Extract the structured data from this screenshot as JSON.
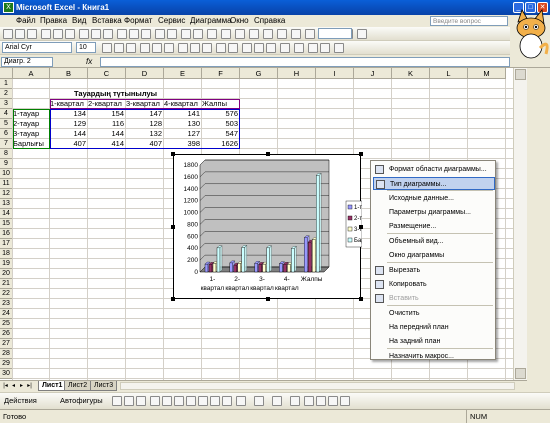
{
  "window": {
    "title": "Microsoft Excel - Книга1"
  },
  "menu": [
    "Файл",
    "Правка",
    "Вид",
    "Вставка",
    "Формат",
    "Сервис",
    "Диаграмма",
    "Окно",
    "Справка"
  ],
  "ask_placeholder": "Введите вопрос",
  "toolbar": {
    "font": "Arial Cyr",
    "size": "10",
    "zoom": ""
  },
  "namebox": "Диагр. 2",
  "fx": "fx",
  "columns": [
    "A",
    "B",
    "C",
    "D",
    "E",
    "F",
    "G",
    "H",
    "I",
    "J",
    "K",
    "L",
    "M"
  ],
  "rows": [
    "1",
    "2",
    "3",
    "4",
    "5",
    "6",
    "7",
    "8",
    "9",
    "10",
    "11",
    "12",
    "13",
    "14",
    "15",
    "16",
    "17",
    "18",
    "19",
    "20",
    "21",
    "22",
    "23",
    "24",
    "25",
    "26",
    "27",
    "28",
    "29",
    "30"
  ],
  "sheet": {
    "title": "Тауардың түтынылуы",
    "headers": [
      "1-квартал",
      "2-квартал",
      "3-квартал",
      "4-квартал",
      "Жалпы"
    ],
    "data": [
      {
        "label": "1-тауар",
        "values": [
          "134",
          "154",
          "147",
          "141",
          "576"
        ]
      },
      {
        "label": "2-тауар",
        "values": [
          "129",
          "116",
          "128",
          "130",
          "503"
        ]
      },
      {
        "label": "3-тауар",
        "values": [
          "144",
          "144",
          "132",
          "127",
          "547"
        ]
      },
      {
        "label": "Барлығы",
        "values": [
          "407",
          "414",
          "407",
          "398",
          "1626"
        ]
      }
    ]
  },
  "chart_data": {
    "type": "bar",
    "categories": [
      "1-квартал",
      "2-квартал",
      "3-квартал",
      "4-квартал",
      "Жалпы"
    ],
    "category_lines": [
      [
        "1-",
        "2-",
        "3-",
        "4-",
        "Жалпы"
      ],
      [
        "квартал",
        "квартал",
        "квартал",
        "квартал",
        ""
      ]
    ],
    "series": [
      {
        "name": "1-тауар",
        "values": [
          134,
          154,
          147,
          141,
          576
        ],
        "color": "#9999ff"
      },
      {
        "name": "2-тауар",
        "values": [
          129,
          116,
          128,
          130,
          503
        ],
        "color": "#993366"
      },
      {
        "name": "3-тауар",
        "values": [
          144,
          144,
          132,
          127,
          547
        ],
        "color": "#ffffcc"
      },
      {
        "name": "Барлығы",
        "values": [
          407,
          414,
          407,
          398,
          1626
        ],
        "color": "#ccffff"
      }
    ],
    "legend_labels": [
      "1-та",
      "2-та",
      "3-та",
      "Бар"
    ],
    "yticks": [
      "0",
      "200",
      "400",
      "600",
      "800",
      "1000",
      "1200",
      "1400",
      "1600",
      "1800"
    ],
    "ylim": [
      0,
      1800
    ],
    "grid": true,
    "legend": "right",
    "wall_color": "#c0c0c0"
  },
  "context_menu": [
    {
      "label": "Формат области диаграммы...",
      "icon": "chart-format-icon"
    },
    {
      "label": "Тип диаграммы...",
      "icon": "chart-type-icon",
      "highlight": true
    },
    {
      "label": "Исходные данные...",
      "icon": ""
    },
    {
      "label": "Параметры диаграммы...",
      "icon": ""
    },
    {
      "label": "Размещение...",
      "icon": ""
    },
    {
      "label": "Объемный вид...",
      "icon": ""
    },
    {
      "label": "Окно диаграммы",
      "icon": ""
    },
    {
      "label": "Вырезать",
      "icon": "scissors-icon"
    },
    {
      "label": "Копировать",
      "icon": "copy-icon"
    },
    {
      "label": "Вставить",
      "icon": "paste-icon",
      "disabled": true
    },
    {
      "label": "Очистить",
      "icon": ""
    },
    {
      "label": "На передний план",
      "icon": ""
    },
    {
      "label": "На задний план",
      "icon": ""
    },
    {
      "label": "Назначить макрос...",
      "icon": ""
    }
  ],
  "tabs": [
    "Лист1",
    "Лист2",
    "Лист3"
  ],
  "drawbar": {
    "actions": "Действия",
    "autoshapes": "Автофигуры"
  },
  "status": {
    "left": "Готово",
    "num": "NUM"
  }
}
